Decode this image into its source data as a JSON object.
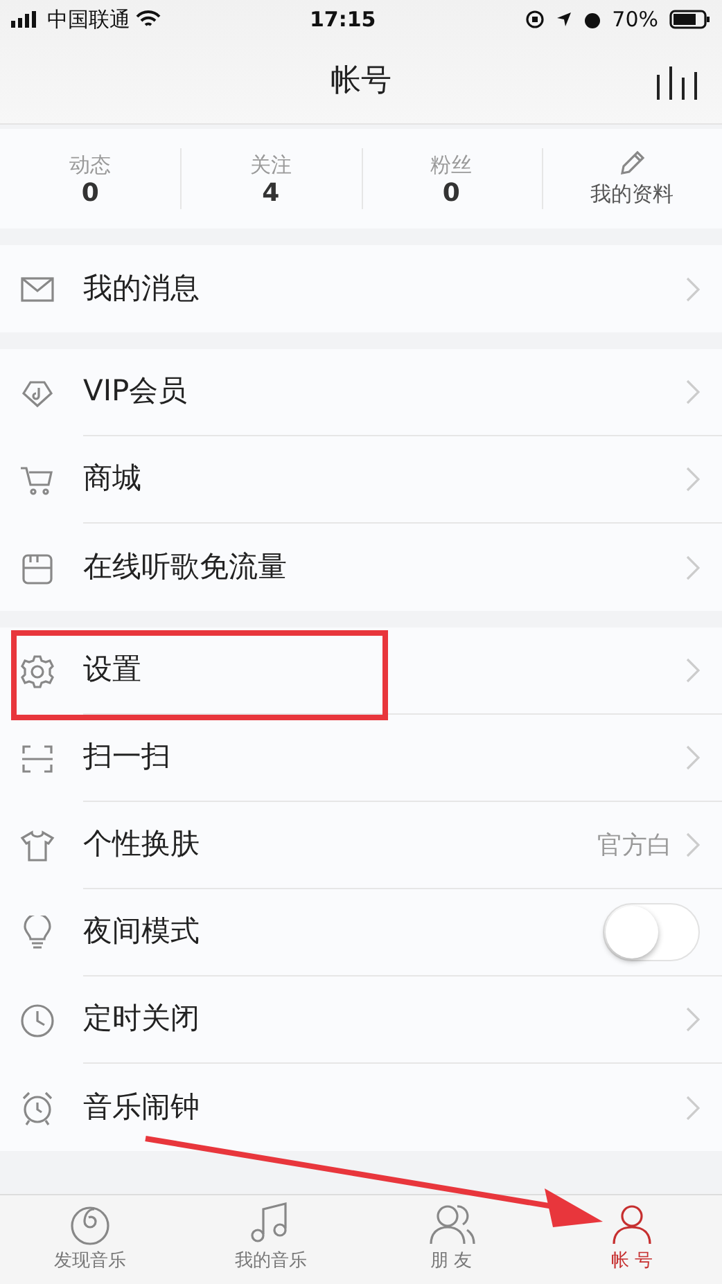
{
  "status_bar": {
    "carrier": "中国联通",
    "time": "17:15",
    "battery": "70%"
  },
  "header": {
    "title": "帐号"
  },
  "stats": [
    {
      "label": "动态",
      "value": "0"
    },
    {
      "label": "关注",
      "value": "4"
    },
    {
      "label": "粉丝",
      "value": "0"
    }
  ],
  "profile_link": {
    "label": "我的资料"
  },
  "sections": [
    {
      "items": [
        {
          "kind": "link",
          "label": "我的消息",
          "highlighted": false
        }
      ]
    },
    {
      "items": [
        {
          "kind": "link",
          "label": "VIP会员",
          "highlighted": false
        },
        {
          "kind": "link",
          "label": "商城",
          "highlighted": false
        },
        {
          "kind": "link",
          "label": "在线听歌免流量",
          "highlighted": false
        }
      ]
    },
    {
      "items": [
        {
          "kind": "link",
          "label": "设置",
          "highlighted": true
        },
        {
          "kind": "link",
          "label": "扫一扫",
          "highlighted": false
        },
        {
          "kind": "value",
          "label": "个性换肤",
          "value": "官方白",
          "highlighted": false
        },
        {
          "kind": "toggle",
          "label": "夜间模式",
          "on": false,
          "highlighted": false
        },
        {
          "kind": "link",
          "label": "定时关闭",
          "highlighted": false
        },
        {
          "kind": "link",
          "label": "音乐闹钟",
          "highlighted": false
        }
      ]
    }
  ],
  "tabs": [
    {
      "label": "发现音乐",
      "selected": false
    },
    {
      "label": "我的音乐",
      "selected": false
    },
    {
      "label": "朋 友",
      "selected": false
    },
    {
      "label": "帐 号",
      "selected": true
    }
  ],
  "arrow_annotation": true
}
